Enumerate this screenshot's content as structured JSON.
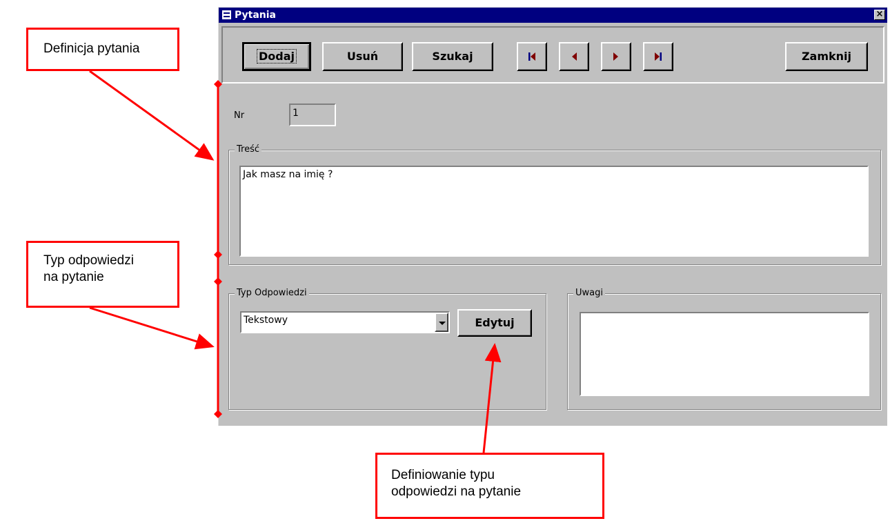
{
  "callouts": {
    "definition": "Definicja pytania",
    "answer_type_line1": "Typ odpowiedzi",
    "answer_type_line2": "na pytanie",
    "defining_line1": "Definiowanie typu",
    "defining_line2": "odpowiedzi na pytanie"
  },
  "window": {
    "title": "Pytania",
    "close_glyph": "×"
  },
  "toolbar": {
    "add_label": "Dodaj",
    "delete_label": "Usuń",
    "search_label": "Szukaj",
    "close_label": "Zamknij",
    "nav_icons": [
      "first-record-icon",
      "previous-record-icon",
      "next-record-icon",
      "last-record-icon"
    ],
    "nav_icon_color": "#800000",
    "nav_bar_color": "#000080"
  },
  "form": {
    "nr_label": "Nr",
    "nr_value": "1",
    "content_label": "Treść",
    "content_value": "Jak masz na imię ?",
    "answer_type_label": "Typ Odpowiedzi",
    "answer_type_value": "Tekstowy",
    "edit_label": "Edytuj",
    "notes_label": "Uwagi",
    "notes_value": ""
  },
  "colors": {
    "window_bg": "#c0c0c0",
    "titlebar": "#000080",
    "annotation": "#ff0000"
  }
}
